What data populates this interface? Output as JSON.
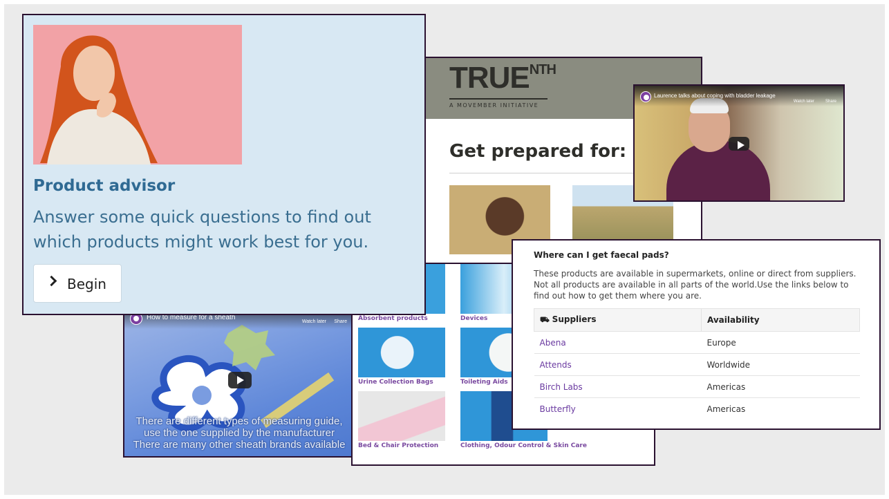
{
  "advisor": {
    "title": "Product advisor",
    "description": "Answer some quick questions to find out which products might work best for you.",
    "button_label": "Begin"
  },
  "truenth": {
    "logo": "TRUE",
    "logo_sup": "NTH",
    "tagline": "A MOVEMBER INITIATIVE",
    "heading": "Get prepared for:"
  },
  "video_laurence": {
    "title": "Laurence talks about coping with bladder leakage",
    "watch_later": "Watch later",
    "share": "Share"
  },
  "video_sheath": {
    "title": "How to measure for a sheath",
    "watch_later": "Watch later",
    "share": "Share",
    "caption_lines": [
      "There are different types of measuring guide,",
      "use the one supplied by the manufacturer",
      "There are many other sheath brands available"
    ]
  },
  "categories": [
    {
      "label": "Absorbent products"
    },
    {
      "label": "Devices"
    },
    {
      "label": "Urine Collection Bags"
    },
    {
      "label": "Toileting Aids"
    },
    {
      "label": "Bed & Chair Protection"
    },
    {
      "label": "Clothing, Odour Control & Skin Care"
    }
  ],
  "pads": {
    "question": "Where can I get faecal pads?",
    "paragraph": "These products are available in supermarkets, online or direct from suppliers. Not all products are available in all parts of the world.Use the links below to find out how to get them where you are.",
    "columns": [
      "Suppliers",
      "Availability"
    ],
    "rows": [
      {
        "supplier": "Abena",
        "availability": "Europe"
      },
      {
        "supplier": "Attends",
        "availability": "Worldwide"
      },
      {
        "supplier": "Birch Labs",
        "availability": "Americas"
      },
      {
        "supplier": "Butterfly",
        "availability": "Americas"
      }
    ]
  },
  "colors": {
    "background": "#ebebeb",
    "advisor_bg": "#d8e8f3",
    "advisor_title": "#2f6a93",
    "border": "#2a1130",
    "link": "#6a3aa0"
  }
}
